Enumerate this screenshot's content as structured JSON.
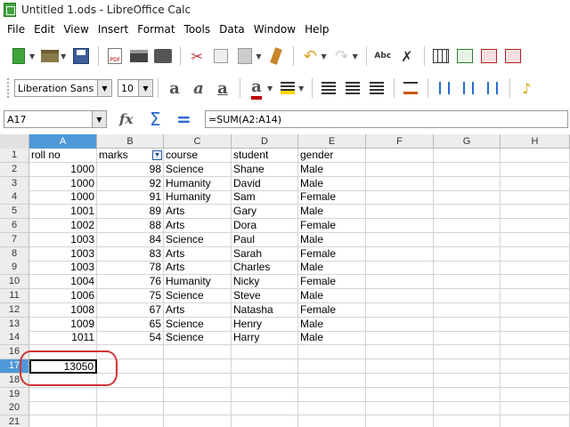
{
  "window": {
    "title": "Untitled 1.ods - LibreOffice Calc"
  },
  "menu": [
    "File",
    "Edit",
    "View",
    "Insert",
    "Format",
    "Tools",
    "Data",
    "Window",
    "Help"
  ],
  "toolbar": {
    "font_name": "Liberation Sans",
    "font_size": "10",
    "pdf_label": "PDF",
    "spell_label": "Abc"
  },
  "formula_bar": {
    "name_box": "A17",
    "formula": "=SUM(A2:A14)"
  },
  "sheet": {
    "columns": [
      "A",
      "B",
      "C",
      "D",
      "E",
      "F",
      "G",
      "H"
    ],
    "selected_column": "A",
    "selected_row": "17",
    "active_cell": "A17",
    "rows": [
      {
        "n": "1",
        "cells": [
          "roll no",
          "marks",
          "course",
          "student",
          "gender"
        ]
      },
      {
        "n": "2",
        "cells": [
          "1000",
          "98",
          "Science",
          "Shane",
          "Male"
        ]
      },
      {
        "n": "3",
        "cells": [
          "1000",
          "92",
          "Humanity",
          "David",
          "Male"
        ]
      },
      {
        "n": "4",
        "cells": [
          "1000",
          "91",
          "Humanity",
          "Sam",
          "Female"
        ]
      },
      {
        "n": "5",
        "cells": [
          "1001",
          "89",
          "Arts",
          "Gary",
          "Male"
        ]
      },
      {
        "n": "6",
        "cells": [
          "1002",
          "88",
          "Arts",
          "Dora",
          "Female"
        ]
      },
      {
        "n": "7",
        "cells": [
          "1003",
          "84",
          "Science",
          "Paul",
          "Male"
        ]
      },
      {
        "n": "8",
        "cells": [
          "1003",
          "83",
          "Arts",
          "Sarah",
          "Female"
        ]
      },
      {
        "n": "9",
        "cells": [
          "1003",
          "78",
          "Arts",
          "Charles",
          "Male"
        ]
      },
      {
        "n": "10",
        "cells": [
          "1004",
          "76",
          "Humanity",
          "Nicky",
          "Female"
        ]
      },
      {
        "n": "11",
        "cells": [
          "1006",
          "75",
          "Science",
          "Steve",
          "Male"
        ]
      },
      {
        "n": "12",
        "cells": [
          "1008",
          "67",
          "Arts",
          "Natasha",
          "Female"
        ]
      },
      {
        "n": "13",
        "cells": [
          "1009",
          "65",
          "Science",
          "Henry",
          "Male"
        ]
      },
      {
        "n": "14",
        "cells": [
          "1011",
          "54",
          "Science",
          "Harry",
          "Male"
        ]
      },
      {
        "n": "16",
        "cells": [
          "",
          "",
          "",
          "",
          ""
        ]
      },
      {
        "n": "17",
        "cells": [
          "13050",
          "",
          "",
          "",
          ""
        ]
      },
      {
        "n": "18",
        "cells": [
          "",
          "",
          "",
          "",
          ""
        ]
      },
      {
        "n": "19",
        "cells": [
          "",
          "",
          "",
          "",
          ""
        ]
      },
      {
        "n": "20",
        "cells": [
          "",
          "",
          "",
          "",
          ""
        ]
      },
      {
        "n": "21",
        "cells": [
          "",
          "",
          "",
          "",
          ""
        ]
      }
    ]
  },
  "colors": {
    "selection_header": "#4f98d8",
    "annotation": "#d03535"
  }
}
